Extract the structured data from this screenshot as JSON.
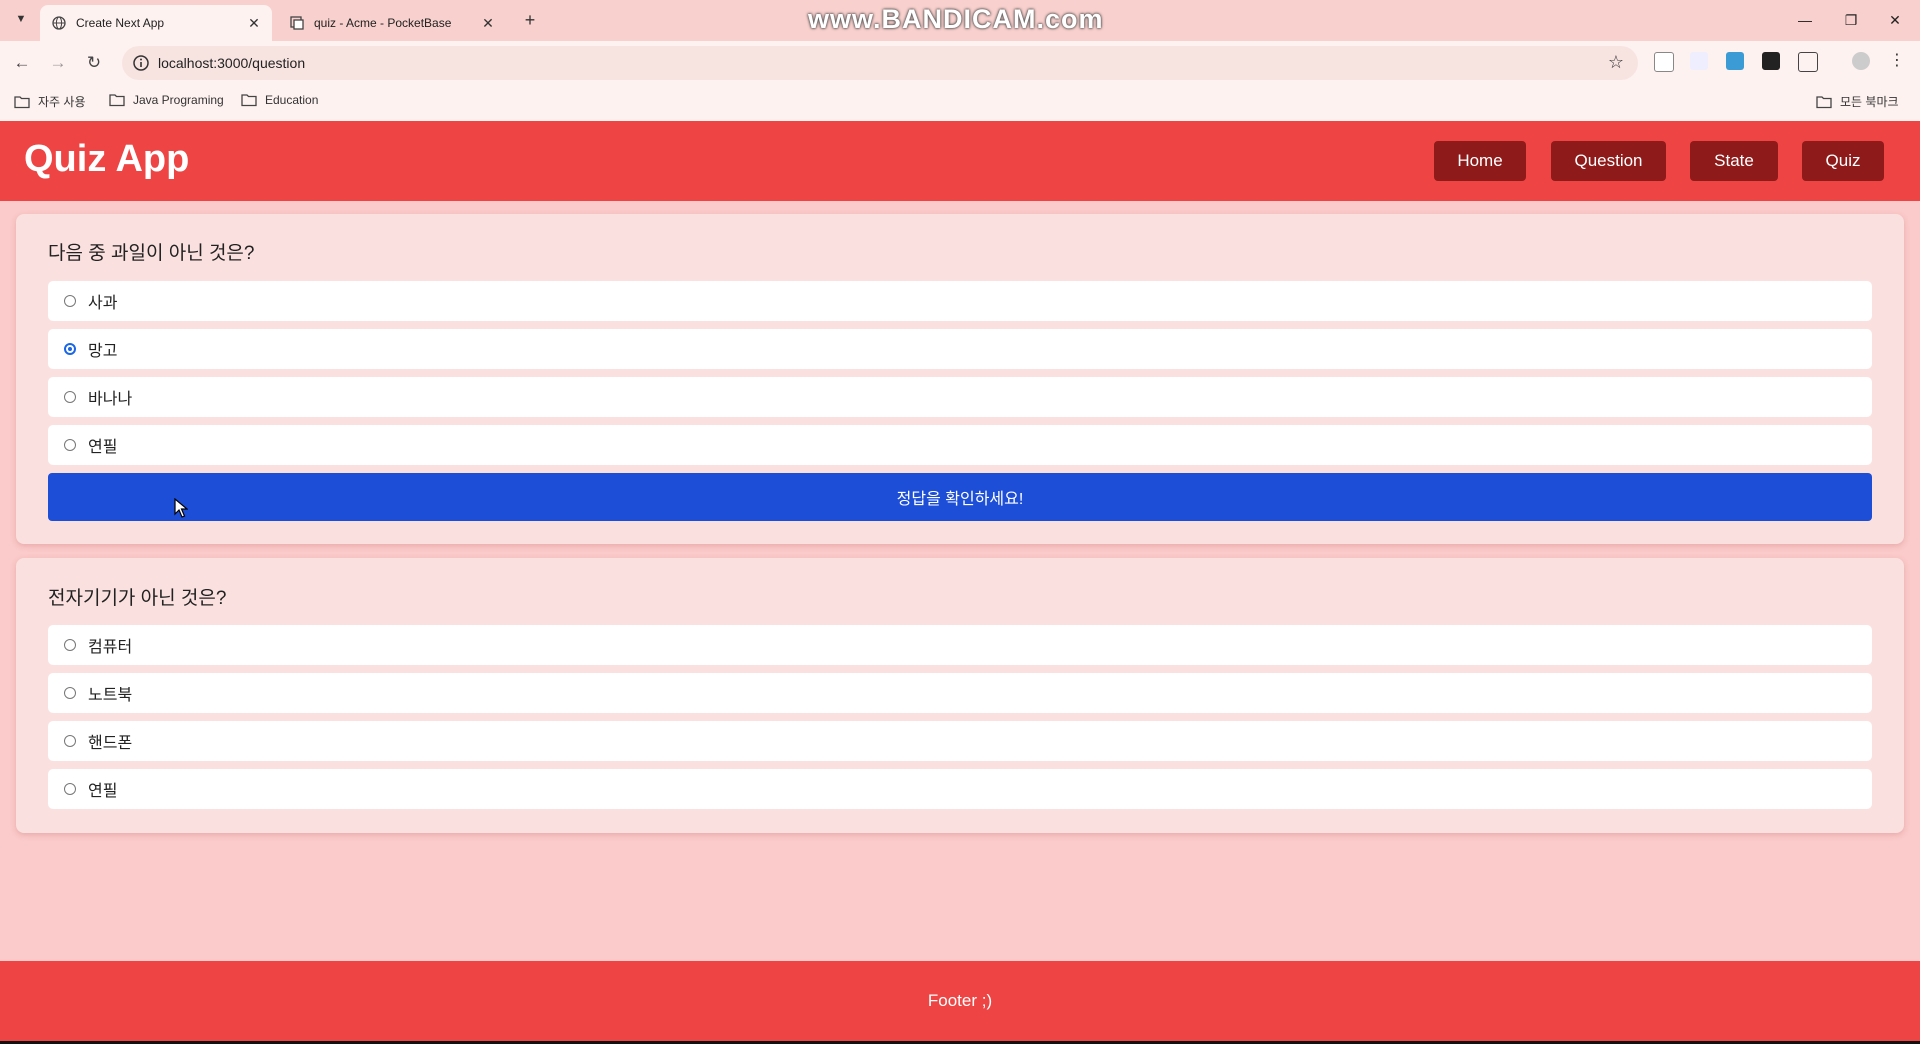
{
  "browser": {
    "tabs": [
      {
        "title": "Create Next App",
        "active": true
      },
      {
        "title": "quiz - Acme - PocketBase",
        "active": false
      }
    ],
    "watermark": "www.BANDICAM.com",
    "url": "localhost:3000/question",
    "bookmarks": [
      {
        "label": "자주 사용"
      },
      {
        "label": "Java Programing"
      },
      {
        "label": "Education"
      }
    ],
    "all_bookmarks_label": "모든 북마크"
  },
  "app": {
    "title": "Quiz App",
    "nav": [
      {
        "label": "Home"
      },
      {
        "label": "Question"
      },
      {
        "label": "State"
      },
      {
        "label": "Quiz"
      }
    ],
    "questions": [
      {
        "text": "다음 중 과일이 아닌 것은?",
        "options": [
          {
            "label": "사과",
            "selected": false
          },
          {
            "label": "망고",
            "selected": true
          },
          {
            "label": "바나나",
            "selected": false
          },
          {
            "label": "연필",
            "selected": false
          }
        ],
        "check_label": "정답을 확인하세요!"
      },
      {
        "text": "전자기기가 아닌 것은?",
        "options": [
          {
            "label": "컴퓨터",
            "selected": false
          },
          {
            "label": "노트북",
            "selected": false
          },
          {
            "label": "핸드폰",
            "selected": false
          },
          {
            "label": "연필",
            "selected": false
          }
        ]
      }
    ],
    "footer": "Footer ;)"
  },
  "colors": {
    "header": "#ee4444",
    "nav_button": "#8e1a1a",
    "check_button": "#1d4ed8",
    "page_bg": "#fbcaca",
    "card_bg": "#fae0de"
  }
}
